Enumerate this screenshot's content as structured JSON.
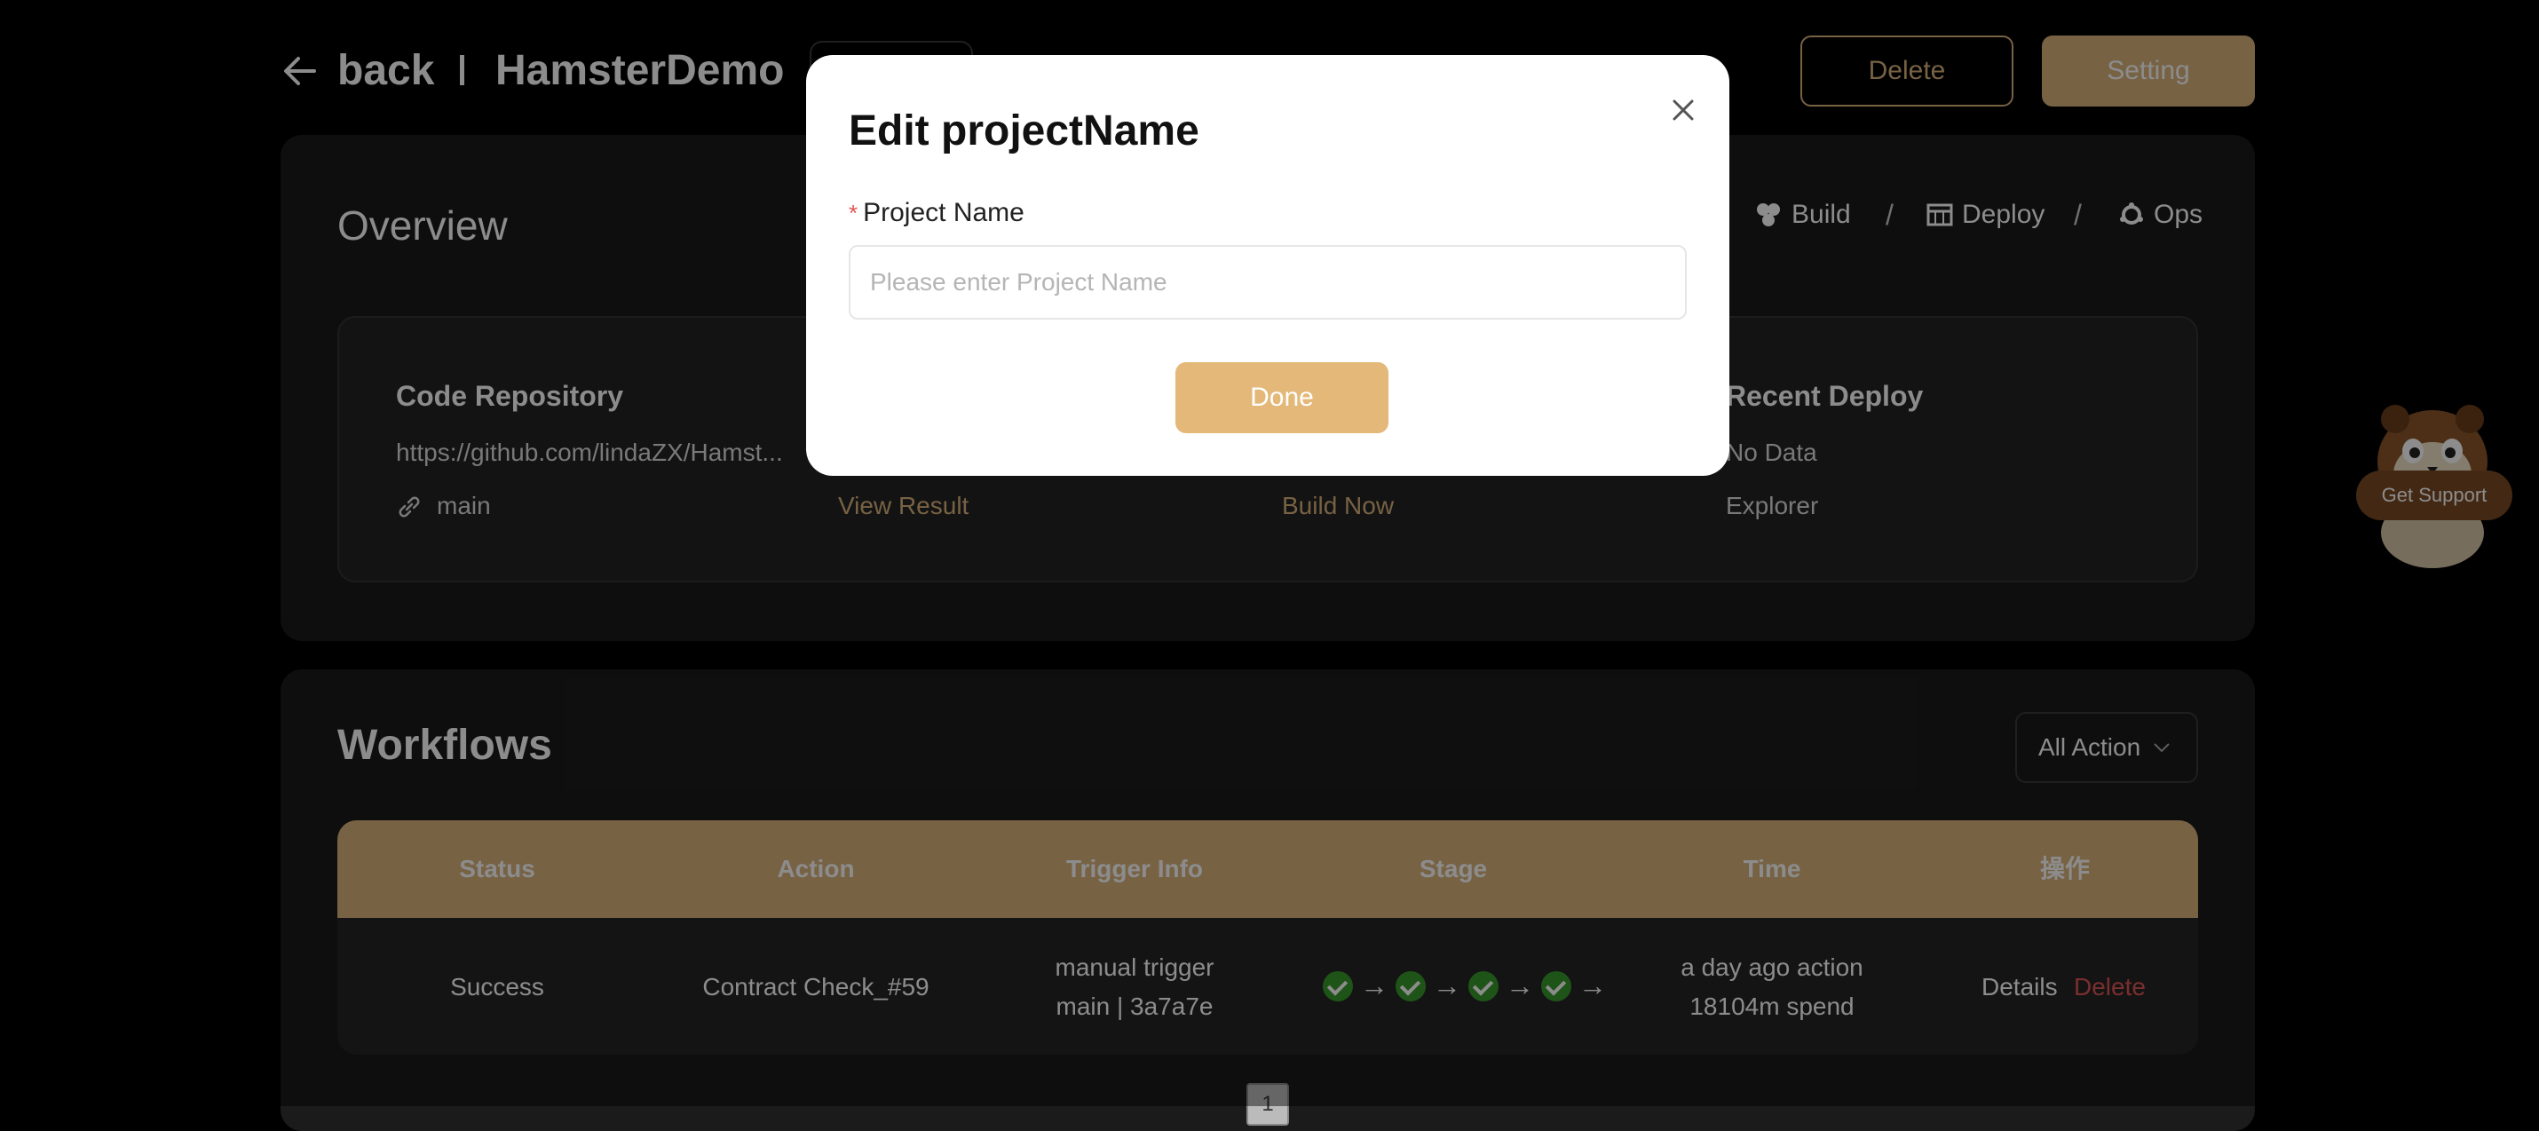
{
  "header": {
    "back_label": "back",
    "project_name": "HamsterDemo",
    "delete_label": "Delete",
    "setting_label": "Setting"
  },
  "overview": {
    "title": "Overview",
    "nav": [
      {
        "label": "Build",
        "icon": "build-icon"
      },
      {
        "label": "Deploy",
        "icon": "deploy-icon"
      },
      {
        "label": "Ops",
        "icon": "ops-icon"
      }
    ],
    "nav_separator": "/",
    "cards": [
      {
        "title": "Code Repository",
        "text": "https://github.com/lindaZX/Hamst...",
        "link": "main"
      },
      {
        "title": "",
        "text": "",
        "link": "View Result"
      },
      {
        "title": "",
        "text": "",
        "link": "Build Now"
      },
      {
        "title": "Recent Deploy",
        "text": "No Data",
        "link": "Explorer"
      }
    ]
  },
  "workflows": {
    "title": "Workflows",
    "filter_value": "All Action",
    "columns": [
      "Status",
      "Action",
      "Trigger Info",
      "Stage",
      "Time",
      "操作"
    ],
    "rows": [
      {
        "status": "Success",
        "action": "Contract Check_#59",
        "trigger_line1": "manual trigger",
        "trigger_line2": "main | 3a7a7e",
        "stages_completed": 4,
        "time_line1": "a day ago action",
        "time_line2": "18104m spend",
        "details_label": "Details",
        "delete_label": "Delete"
      }
    ],
    "page": "1"
  },
  "modal": {
    "title": "Edit projectName",
    "field_label": "Project Name",
    "required_mark": "*",
    "placeholder": "Please enter Project Name",
    "value": "",
    "done_label": "Done"
  },
  "support": {
    "label": "Get Support"
  },
  "colors": {
    "accent": "#d9b37d",
    "danger": "#e05555",
    "success": "#3a9a2c",
    "background": "#000000",
    "panel": "#1b1b1b"
  }
}
